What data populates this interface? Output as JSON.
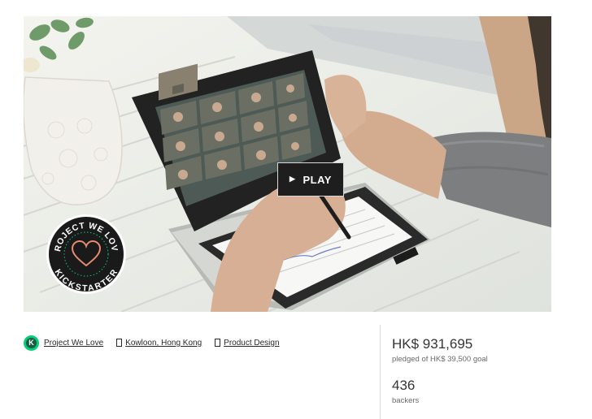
{
  "video": {
    "play_label": "PLAY",
    "badge_top_text": "PROJECT WE LOVE",
    "badge_bottom_text": "KICKSTARTER"
  },
  "tags": {
    "project_we_love": "Project We Love",
    "location": "Kowloon, Hong Kong",
    "category": "Product Design"
  },
  "stats": {
    "pledged_amount": "HK$ 931,695",
    "pledged_caption": "pledged of HK$ 39,500 goal",
    "backers_count": "436",
    "backers_caption": "backers"
  },
  "colors": {
    "kickstarter_green": "#05ce78",
    "badge_dark": "#1a1a1a",
    "heart_stroke": "#e58b70"
  }
}
